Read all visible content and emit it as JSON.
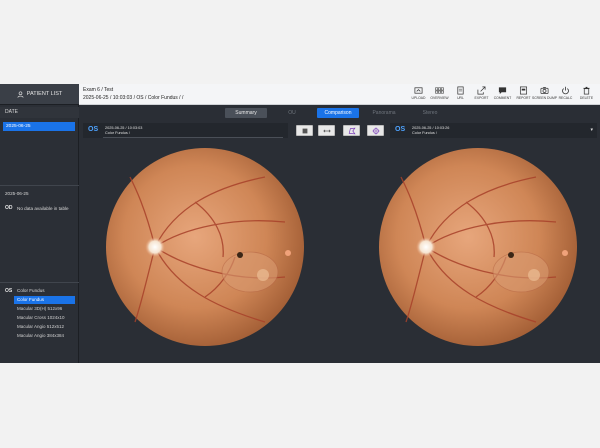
{
  "sidebar": {
    "patient_list_label": "PATIENT LIST",
    "date_header": "DATE",
    "dates": [
      "2025-06-25"
    ],
    "od_section": {
      "date": "2025-06-25",
      "eye": "OD",
      "message": "No data available in table"
    },
    "os_section": {
      "eye": "OS",
      "group_label": "Color Fundus",
      "items": [
        {
          "label": "Color Fundus",
          "selected": true
        },
        {
          "label": "Macular 3D(H) 512x96",
          "selected": false
        },
        {
          "label": "Macular Cross 1024x10",
          "selected": false
        },
        {
          "label": "Macular Angio 512x512",
          "selected": false
        },
        {
          "label": "Macular Angio 384x384",
          "selected": false
        }
      ]
    }
  },
  "header": {
    "title": "Exam 6 / Test",
    "subtitle": "2025-06-25 / 10:03:03 / OS / Color Fundus / /"
  },
  "toolbar": [
    {
      "label": "UPLOAD",
      "icon": "upload-icon"
    },
    {
      "label": "OVERVIEW",
      "icon": "grid-icon"
    },
    {
      "label": "URL",
      "icon": "document-icon"
    },
    {
      "label": "EXPORT",
      "icon": "export-icon"
    },
    {
      "label": "COMMENT",
      "icon": "comment-icon"
    },
    {
      "label": "REPORT",
      "icon": "report-icon"
    },
    {
      "label": "SCREEN DUMP",
      "icon": "camera-icon"
    },
    {
      "label": "RECALC",
      "icon": "power-icon"
    },
    {
      "label": "DELETE",
      "icon": "trash-icon"
    }
  ],
  "tabs": [
    {
      "label": "Summary",
      "state": "summary"
    },
    {
      "label": "OU",
      "state": "disabled"
    },
    {
      "label": "Comparison",
      "state": "active"
    },
    {
      "label": "Panorama",
      "state": "disabled"
    },
    {
      "label": "Stereo",
      "state": "disabled"
    }
  ],
  "panes": [
    {
      "eye": "OS",
      "datetime": "2025-06-25 / 10:03:03",
      "type": "Color Fundus /"
    },
    {
      "eye": "OS",
      "datetime": "2025-06-25 / 10:03:26",
      "type": "Color Fundus /",
      "dropdown": "▾"
    }
  ],
  "colors": {
    "accent": "#1a73e8",
    "eye_label": "#4ea3ff",
    "marker": "#f0a27a"
  }
}
